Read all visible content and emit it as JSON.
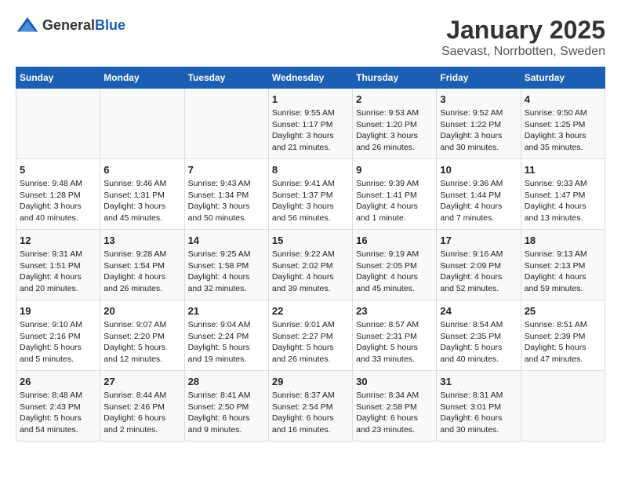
{
  "header": {
    "logo_general": "General",
    "logo_blue": "Blue",
    "month": "January 2025",
    "location": "Saevast, Norrbotten, Sweden"
  },
  "days_of_week": [
    "Sunday",
    "Monday",
    "Tuesday",
    "Wednesday",
    "Thursday",
    "Friday",
    "Saturday"
  ],
  "weeks": [
    [
      {
        "day": "",
        "content": ""
      },
      {
        "day": "",
        "content": ""
      },
      {
        "day": "",
        "content": ""
      },
      {
        "day": "1",
        "content": "Sunrise: 9:55 AM\nSunset: 1:17 PM\nDaylight: 3 hours and 21 minutes."
      },
      {
        "day": "2",
        "content": "Sunrise: 9:53 AM\nSunset: 1:20 PM\nDaylight: 3 hours and 26 minutes."
      },
      {
        "day": "3",
        "content": "Sunrise: 9:52 AM\nSunset: 1:22 PM\nDaylight: 3 hours and 30 minutes."
      },
      {
        "day": "4",
        "content": "Sunrise: 9:50 AM\nSunset: 1:25 PM\nDaylight: 3 hours and 35 minutes."
      }
    ],
    [
      {
        "day": "5",
        "content": "Sunrise: 9:48 AM\nSunset: 1:28 PM\nDaylight: 3 hours and 40 minutes."
      },
      {
        "day": "6",
        "content": "Sunrise: 9:46 AM\nSunset: 1:31 PM\nDaylight: 3 hours and 45 minutes."
      },
      {
        "day": "7",
        "content": "Sunrise: 9:43 AM\nSunset: 1:34 PM\nDaylight: 3 hours and 50 minutes."
      },
      {
        "day": "8",
        "content": "Sunrise: 9:41 AM\nSunset: 1:37 PM\nDaylight: 3 hours and 56 minutes."
      },
      {
        "day": "9",
        "content": "Sunrise: 9:39 AM\nSunset: 1:41 PM\nDaylight: 4 hours and 1 minute."
      },
      {
        "day": "10",
        "content": "Sunrise: 9:36 AM\nSunset: 1:44 PM\nDaylight: 4 hours and 7 minutes."
      },
      {
        "day": "11",
        "content": "Sunrise: 9:33 AM\nSunset: 1:47 PM\nDaylight: 4 hours and 13 minutes."
      }
    ],
    [
      {
        "day": "12",
        "content": "Sunrise: 9:31 AM\nSunset: 1:51 PM\nDaylight: 4 hours and 20 minutes."
      },
      {
        "day": "13",
        "content": "Sunrise: 9:28 AM\nSunset: 1:54 PM\nDaylight: 4 hours and 26 minutes."
      },
      {
        "day": "14",
        "content": "Sunrise: 9:25 AM\nSunset: 1:58 PM\nDaylight: 4 hours and 32 minutes."
      },
      {
        "day": "15",
        "content": "Sunrise: 9:22 AM\nSunset: 2:02 PM\nDaylight: 4 hours and 39 minutes."
      },
      {
        "day": "16",
        "content": "Sunrise: 9:19 AM\nSunset: 2:05 PM\nDaylight: 4 hours and 45 minutes."
      },
      {
        "day": "17",
        "content": "Sunrise: 9:16 AM\nSunset: 2:09 PM\nDaylight: 4 hours and 52 minutes."
      },
      {
        "day": "18",
        "content": "Sunrise: 9:13 AM\nSunset: 2:13 PM\nDaylight: 4 hours and 59 minutes."
      }
    ],
    [
      {
        "day": "19",
        "content": "Sunrise: 9:10 AM\nSunset: 2:16 PM\nDaylight: 5 hours and 5 minutes."
      },
      {
        "day": "20",
        "content": "Sunrise: 9:07 AM\nSunset: 2:20 PM\nDaylight: 5 hours and 12 minutes."
      },
      {
        "day": "21",
        "content": "Sunrise: 9:04 AM\nSunset: 2:24 PM\nDaylight: 5 hours and 19 minutes."
      },
      {
        "day": "22",
        "content": "Sunrise: 9:01 AM\nSunset: 2:27 PM\nDaylight: 5 hours and 26 minutes."
      },
      {
        "day": "23",
        "content": "Sunrise: 8:57 AM\nSunset: 2:31 PM\nDaylight: 5 hours and 33 minutes."
      },
      {
        "day": "24",
        "content": "Sunrise: 8:54 AM\nSunset: 2:35 PM\nDaylight: 5 hours and 40 minutes."
      },
      {
        "day": "25",
        "content": "Sunrise: 8:51 AM\nSunset: 2:39 PM\nDaylight: 5 hours and 47 minutes."
      }
    ],
    [
      {
        "day": "26",
        "content": "Sunrise: 8:48 AM\nSunset: 2:43 PM\nDaylight: 5 hours and 54 minutes."
      },
      {
        "day": "27",
        "content": "Sunrise: 8:44 AM\nSunset: 2:46 PM\nDaylight: 6 hours and 2 minutes."
      },
      {
        "day": "28",
        "content": "Sunrise: 8:41 AM\nSunset: 2:50 PM\nDaylight: 6 hours and 9 minutes."
      },
      {
        "day": "29",
        "content": "Sunrise: 8:37 AM\nSunset: 2:54 PM\nDaylight: 6 hours and 16 minutes."
      },
      {
        "day": "30",
        "content": "Sunrise: 8:34 AM\nSunset: 2:58 PM\nDaylight: 6 hours and 23 minutes."
      },
      {
        "day": "31",
        "content": "Sunrise: 8:31 AM\nSunset: 3:01 PM\nDaylight: 6 hours and 30 minutes."
      },
      {
        "day": "",
        "content": ""
      }
    ]
  ]
}
